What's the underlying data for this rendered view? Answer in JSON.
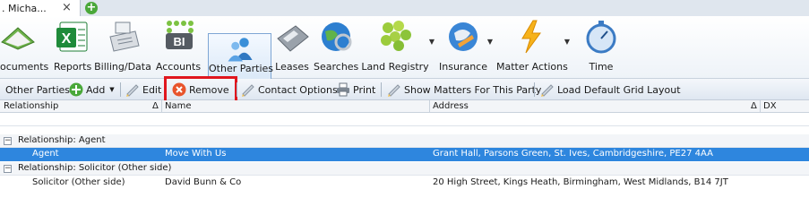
{
  "tabs": {
    "doc_title": ". Micha...",
    "close_glyph": "×",
    "new_glyph": "+"
  },
  "ribbon": {
    "items": [
      {
        "label": "ocuments",
        "icon": "documents-icon"
      },
      {
        "label": "Reports",
        "icon": "excel-icon"
      },
      {
        "label": "Billing/Data",
        "icon": "cash-register-icon"
      },
      {
        "label": "Accounts",
        "icon": "bi-icon"
      },
      {
        "label": "Other Parties",
        "icon": "people-icon"
      },
      {
        "label": "Leases",
        "icon": "calculator-icon"
      },
      {
        "label": "Searches",
        "icon": "globe-search-icon"
      },
      {
        "label": "Land Registry",
        "icon": "land-registry-icon"
      },
      {
        "label": "Insurance",
        "icon": "insurance-globe-icon"
      },
      {
        "label": "Matter Actions",
        "icon": "lightning-icon"
      },
      {
        "label": "Time",
        "icon": "stopwatch-icon"
      }
    ],
    "bi_text": "BI"
  },
  "toolbar": {
    "title": "Other Parties",
    "add": "Add",
    "edit": "Edit",
    "remove": "Remove",
    "contact_options": "Contact Options",
    "print": "Print",
    "show_matters": "Show Matters For This Party",
    "load_layout": "Load Default Grid Layout"
  },
  "grid": {
    "columns": [
      "Relationship",
      "Name",
      "Address",
      "DX"
    ],
    "sort_glyph": "Δ",
    "groups": [
      {
        "header": "Relationship: Agent",
        "rows": [
          {
            "relationship": "Agent",
            "name": "Move With Us",
            "address": "Grant Hall, Parsons Green, St. Ives, Cambridgeshire, PE27 4AA",
            "selected": true
          }
        ]
      },
      {
        "header": "Relationship: Solicitor (Other side)",
        "rows": [
          {
            "relationship": "Solicitor (Other side)",
            "name": "David Bunn & Co",
            "address": "20 High Street, Kings Heath, Birmingham, West Midlands, B14 7JT",
            "selected": false
          }
        ]
      }
    ],
    "collapse_glyph": "−"
  },
  "colors": {
    "selection": "#2e86de",
    "highlight_box": "#e0161e",
    "accent_green": "#4aa83a"
  }
}
